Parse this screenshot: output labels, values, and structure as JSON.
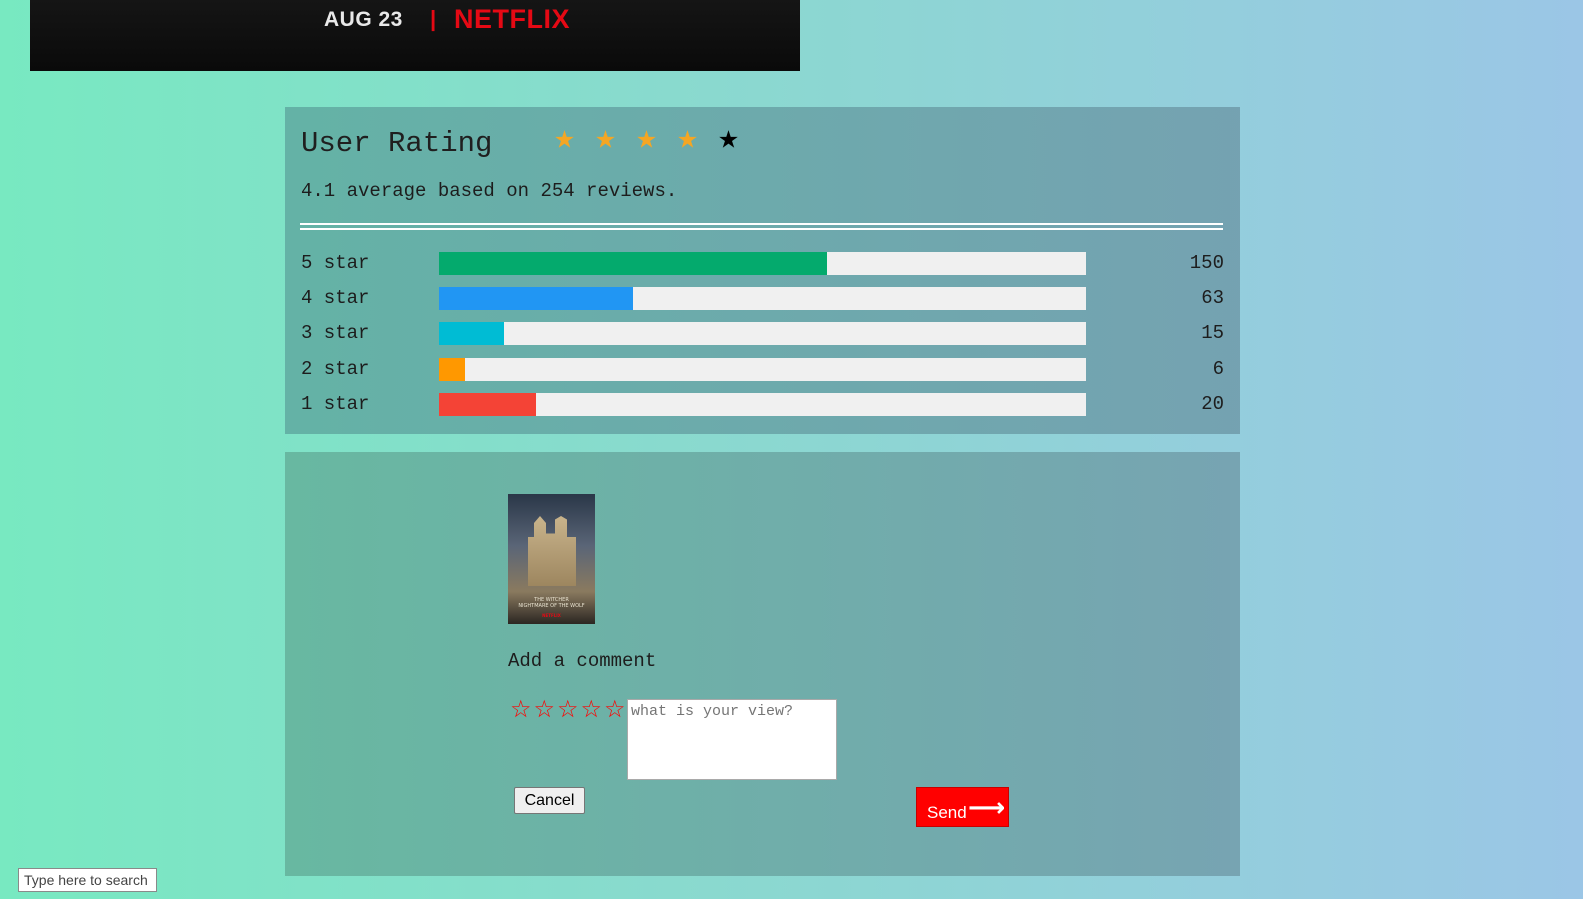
{
  "banner": {
    "date": "AUG 23",
    "separator": "|",
    "brand": "NETFLIX"
  },
  "rating": {
    "title": "User Rating",
    "stars": {
      "filled": 4,
      "total": 5
    },
    "summary": "4.1 average based on 254 reviews.",
    "rows": [
      {
        "label": "5 star",
        "count": "150",
        "fill_percent": 60,
        "color": "#04aa6d"
      },
      {
        "label": "4 star",
        "count": "63",
        "fill_percent": 30,
        "color": "#2196f3"
      },
      {
        "label": "3 star",
        "count": "15",
        "fill_percent": 10,
        "color": "#00bcd4"
      },
      {
        "label": "2 star",
        "count": "6",
        "fill_percent": 4,
        "color": "#ff9800"
      },
      {
        "label": "1 star",
        "count": "20",
        "fill_percent": 15,
        "color": "#f44336"
      }
    ]
  },
  "comment": {
    "poster": {
      "title_line": "THE WITCHER\nNIGHTMARE OF THE WOLF",
      "brand": "NETFLIX"
    },
    "heading": "Add a comment",
    "star_count": 5,
    "placeholder": "what is your view?",
    "cancel_label": "Cancel",
    "send_label": "Send",
    "send_icon": "arrow-right-icon"
  },
  "taskbar": {
    "search_placeholder": "Type here to search"
  },
  "colors": {
    "star_filled": "#f5a623",
    "star_empty": "#000000",
    "comment_star": "#ff0000",
    "send_button": "#ff0000",
    "brand_red": "#e50914"
  }
}
